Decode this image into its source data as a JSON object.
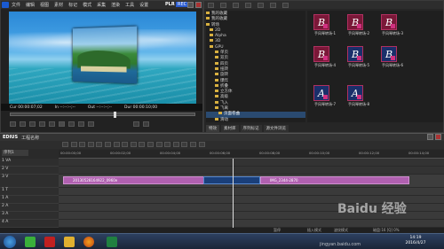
{
  "player": {
    "menu": [
      "文件",
      "编辑",
      "视图",
      "素材",
      "标记",
      "模式",
      "采集",
      "渲染",
      "工具",
      "设置"
    ],
    "badge": "PLR",
    "rec_badge": "REC",
    "cur_label": "Cur 00:00:07;02",
    "in_label": "In --:--:--;--",
    "out_label": "Out --:--:--;--",
    "dur_label": "Dur 00:00:10;00",
    "total_label": "Ttl 00:00:10;00"
  },
  "library": {
    "menu": [
      "文件",
      "编辑",
      "视图",
      "素材",
      "标记",
      "模式"
    ],
    "tree": [
      {
        "label": "我的收藏",
        "sel": false
      },
      {
        "label": "我的收藏",
        "sel": false
      },
      {
        "label": "转场",
        "sel": false
      },
      {
        "label": "2D",
        "sel": false
      },
      {
        "label": "Alpha",
        "sel": false
      },
      {
        "label": "3D",
        "sel": false
      },
      {
        "label": "GPU",
        "sel": false
      },
      {
        "label": "单页",
        "sel": false
      },
      {
        "label": "双页",
        "sel": false
      },
      {
        "label": "四页",
        "sel": false
      },
      {
        "label": "扭转",
        "sel": false
      },
      {
        "label": "旋转",
        "sel": false
      },
      {
        "label": "爆炸",
        "sel": false
      },
      {
        "label": "折叠",
        "sel": false
      },
      {
        "label": "立方体",
        "sel": false
      },
      {
        "label": "高级",
        "sel": false
      },
      {
        "label": "飞入",
        "sel": false
      },
      {
        "label": "飞离",
        "sel": false
      },
      {
        "label": "页面卷曲",
        "sel": true
      },
      {
        "label": "滑动",
        "sel": false
      },
      {
        "label": "翻转",
        "sel": false
      },
      {
        "label": "变形",
        "sel": false
      },
      {
        "label": "百叶",
        "sel": false
      },
      {
        "label": "涟漪",
        "sel": false
      },
      {
        "label": "溶化",
        "sel": false
      },
      {
        "label": "色度",
        "sel": false
      }
    ],
    "tiles": [
      {
        "letter": "B",
        "label": "手风琴转场-1",
        "color": "#7a1838"
      },
      {
        "letter": "B",
        "label": "手风琴转场-2",
        "color": "#7a1838"
      },
      {
        "letter": "B",
        "label": "手风琴转场-3",
        "color": "#7a1838"
      },
      {
        "letter": "B",
        "label": "手风琴转场-4",
        "color": "#7a1838"
      },
      {
        "letter": "B",
        "label": "手风琴转场-5",
        "color": "#1a2f6a"
      },
      {
        "letter": "B",
        "label": "手风琴转场-6",
        "color": "#1a2f6a"
      },
      {
        "letter": "A",
        "label": "手风琴转场-7",
        "color": "#1a2f6a"
      },
      {
        "letter": "A",
        "label": "手风琴转场-8",
        "color": "#1a2f6a"
      }
    ],
    "tabs": [
      "特效",
      "素材库",
      "序列标记",
      "源文件浏览"
    ]
  },
  "timeline": {
    "title": "EDIUS",
    "project": "工程名称",
    "sequence": "序列1",
    "playhead": "00:00:06;15",
    "tracks": [
      "1 VA",
      "2 V",
      "3 V",
      "1 T",
      "1 A",
      "2 A",
      "3 A",
      "4 A"
    ],
    "clip_a": "20130528164922_0960e",
    "clip_b": "IMG_2344-2870",
    "ruler": [
      "00:00:00;00",
      "00:00:02;00",
      "00:00:04;00",
      "00:00:06;00",
      "00:00:08;00",
      "00:00:10;00",
      "00:00:12;00",
      "00:00:14;00"
    ]
  },
  "status": {
    "left": "暂停",
    "mid": "插入模式",
    "right": "波纹模式",
    "disk": "磁盘:16 [Q] 0%"
  },
  "watermark": {
    "text": "Baidu 经验",
    "sub": "jingyan.baidu.com"
  },
  "taskbar": {
    "time": "14:19",
    "date": "2016/4/27"
  }
}
